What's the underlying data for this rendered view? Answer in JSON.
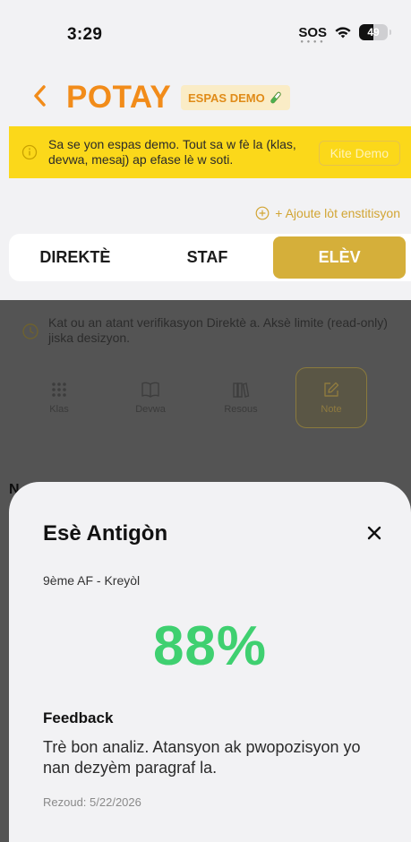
{
  "status_bar": {
    "time": "3:29",
    "sos": "SOS",
    "battery": "49"
  },
  "header": {
    "title": "POTAY",
    "demo_pill": "ESPAS DEMO"
  },
  "demo_banner": {
    "text": "Sa se yon espas demo. Tout sa w fè la (klas, devwa, mesaj) ap efase lè w soti.",
    "button": "Kite Demo"
  },
  "add_institution": "+ Ajoute lòt enstitisyon",
  "tabs": [
    {
      "label": "DIREKTÈ",
      "active": false
    },
    {
      "label": "STAF",
      "active": false
    },
    {
      "label": "ELÈV",
      "active": true
    }
  ],
  "background": {
    "warning": "Kat ou an atant verifikasyon Direktè a. Aksè limite (read-only) jiska desizyon.",
    "quick_actions": [
      {
        "label": "Klas",
        "icon": "grid-icon"
      },
      {
        "label": "Devwa",
        "icon": "book-icon"
      },
      {
        "label": "Resous",
        "icon": "library-icon"
      },
      {
        "label": "Note",
        "icon": "edit-icon"
      }
    ],
    "peek_text": "N"
  },
  "sheet": {
    "student_name": "Esè Antigòn",
    "class": "9ème AF - Kreyòl",
    "score": "88%",
    "feedback_heading": "Feedback",
    "feedback": "Trè bon analiz. Atansyon ak pwopozisyon yo nan dezyèm paragraf la.",
    "submitted": "Rezoud: 5/22/2026"
  },
  "colors": {
    "brand_orange": "#f28c1a",
    "gold": "#d5af3a",
    "banner_yellow": "#fbd81a",
    "score_green": "#3fd070"
  }
}
